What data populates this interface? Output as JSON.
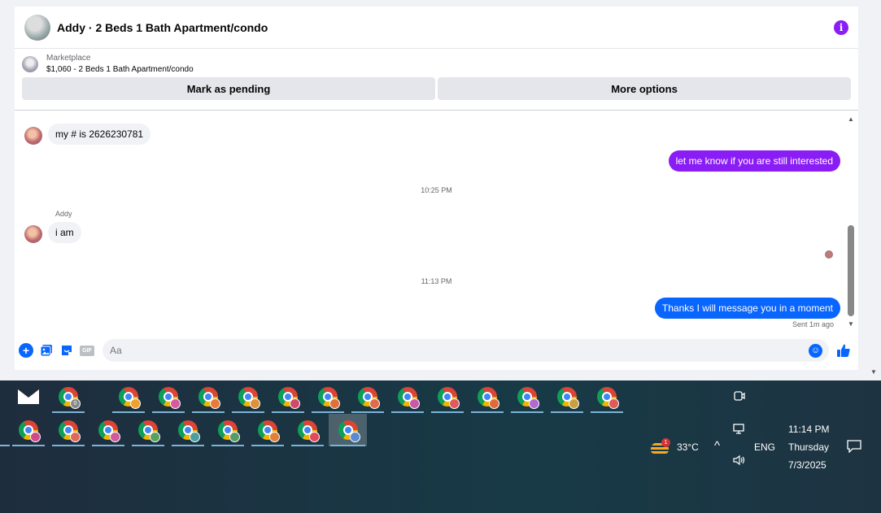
{
  "header": {
    "title": "Addy · 2 Beds 1 Bath Apartment/condo",
    "info_icon": "info-icon",
    "info_glyph": "i"
  },
  "listing": {
    "source": "Marketplace",
    "summary": "$1,060 - 2 Beds 1 Bath Apartment/condo",
    "mark_pending_label": "Mark as pending",
    "more_options_label": "More options"
  },
  "messages": {
    "m1_text": "my # is 2626230781",
    "m2_text": "let me know if you are still interested",
    "ts1": "10:25 PM",
    "sender_name": "Addy",
    "m3_text": "i am",
    "ts2": "11:13 PM",
    "m4_text": "Thanks I will message you in a moment",
    "sent_status": "Sent 1m ago",
    "outgoing_color_purple": "#8a1cf5",
    "outgoing_color_blue": "#0866ff"
  },
  "composer": {
    "placeholder": "Aa",
    "gif_label": "GIF",
    "plus_glyph": "+",
    "like_glyph": "👍",
    "emoji_glyph": "☺"
  },
  "taskbar": {
    "mail_icon": "mail-icon",
    "first_app_badge_count": "0",
    "weather_temp": "33°C",
    "weather_badge": "1",
    "language": "ENG",
    "time": "11:14 PM",
    "day": "Thursday",
    "date": "7/3/2025",
    "chevron_glyph": "^",
    "volume_glyph": "🔊"
  }
}
